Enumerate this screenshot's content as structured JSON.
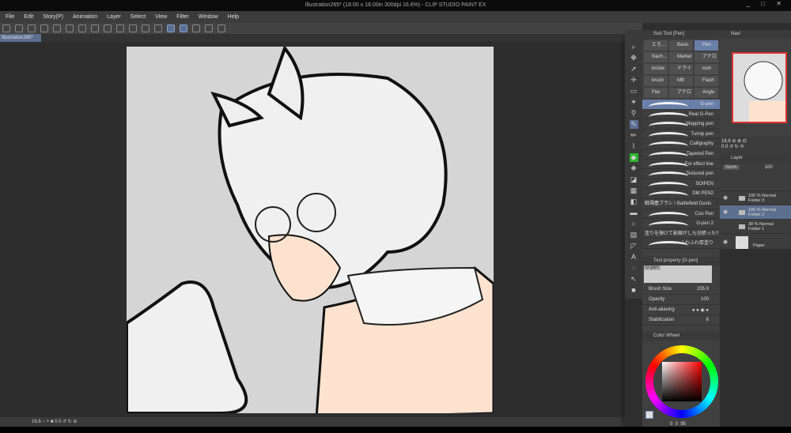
{
  "window": {
    "title": "Illustration265* (18.00 x 18.00in 300dpi 16.6%) - CLIP STUDIO PAINT EX",
    "controls": "_ □ ✕"
  },
  "menu": [
    "File",
    "Edit",
    "Story(P)",
    "Animation",
    "Layer",
    "Select",
    "View",
    "Filter",
    "Window",
    "Help"
  ],
  "tab": {
    "label": "Illustration265*"
  },
  "subtool": {
    "title": "Sub Tool [Pen]",
    "groups": [
      "とろ…",
      "Basic",
      "Pen",
      "Nach…",
      "Marker",
      "アナロ",
      "bristle",
      "ドライ",
      "losh",
      "brush",
      "MB",
      "Flash",
      "Flat",
      "アナロ",
      "Angle"
    ],
    "brushes": [
      "G-pen",
      "Real G-Pen",
      "Mapping pen",
      "Turnip pen",
      "Calligraphy",
      "Tapered Pen",
      "For effect line",
      "Textured pen",
      "SOIPEN",
      "DM PEN2",
      "戦場塵ブラシ / Battlefield Dusts",
      "Coo Pen",
      "G-pen 2",
      "塗りを弾けて影線がしも効張った?",
      "ふわふわ厚塗り"
    ]
  },
  "navigator": {
    "title": "Navi",
    "zoom": "16.6",
    "angle": "0.0"
  },
  "layers": {
    "title": "Layer",
    "blend": "Norm",
    "opacity": "100",
    "items": [
      {
        "info": "100 % Normal",
        "name": "Folder 3"
      },
      {
        "info": "100 % Normal",
        "name": "Folder 2"
      },
      {
        "info": "38 % Normal",
        "name": "Folder 1"
      },
      {
        "info": "",
        "name": "Paper"
      }
    ]
  },
  "toolprop": {
    "title": "Tool property [G-pen]",
    "preview_label": "G-pen",
    "brush_size_label": "Brush Size",
    "brush_size": "205.9",
    "opacity_label": "Opacity",
    "opacity": "100",
    "antialias_label": "Anti-aliasing",
    "stabilization_label": "Stabilization",
    "stabilization": "6"
  },
  "colorwheel": {
    "title": "Color Wheel",
    "values": "0  0  95"
  },
  "status": {
    "zoom": "16.6",
    "angle": "0.0"
  }
}
